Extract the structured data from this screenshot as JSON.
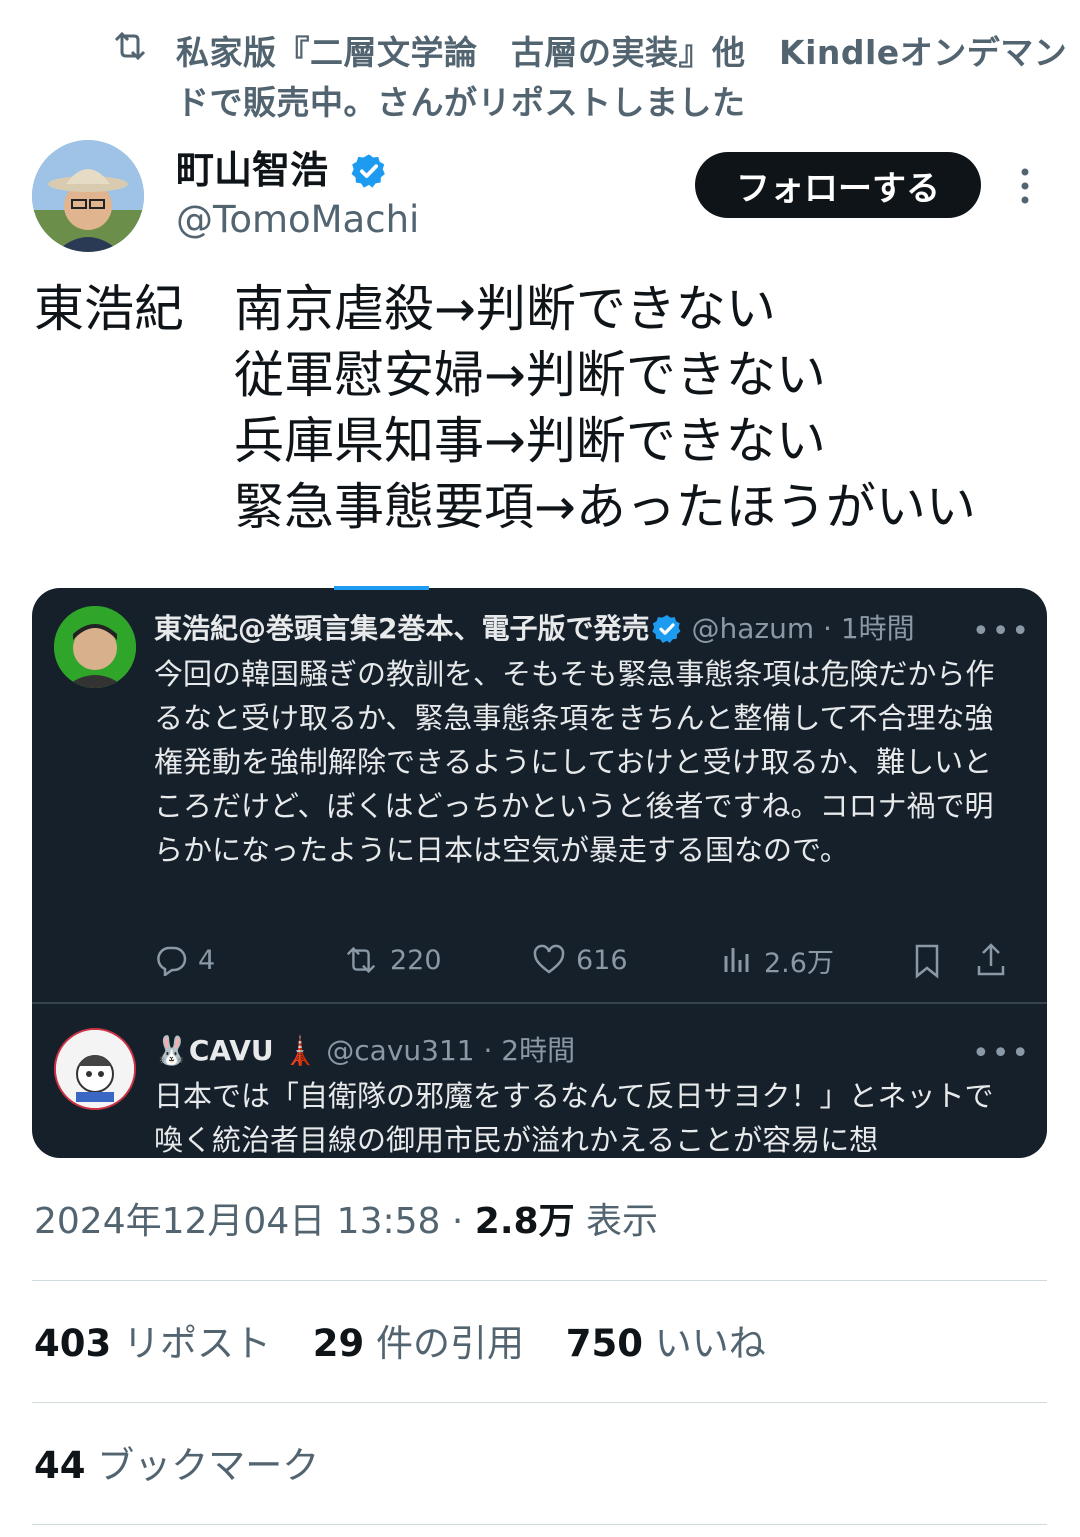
{
  "repost_header": {
    "text": "私家版『二層文学論　古層の実装』他　Kindleオンデマンドで販売中。さんがリポストしました",
    "icon": "repost-icon"
  },
  "author": {
    "name": "町山智浩",
    "handle": "@TomoMachi",
    "verified": true,
    "follow_label": "フォローする"
  },
  "post": {
    "label": "東浩紀",
    "lines": [
      "南京虐殺→判断できない",
      "従軍慰安婦→判断できない",
      "兵庫県知事→判断できない",
      "緊急事態要項→あったほうがいい"
    ]
  },
  "quoted": {
    "name": "東浩紀@巻頭言集2巻本、電子版で発売",
    "handle": "@hazum",
    "time": "1時間",
    "text": "今回の韓国騒ぎの教訓を、そもそも緊急事態条項は危険だから作るなと受け取るか、緊急事態条項をきちんと整備して不合理な強権発動を強制解除できるようにしておけと受け取るか、難しいところだけど、ぼくはどっちかというと後者ですね。コロナ禍で明らかになったように日本は空気が暴走する国なので。",
    "replies": "4",
    "reposts": "220",
    "likes": "616",
    "views": "2.6万"
  },
  "reply": {
    "name": "CAVU",
    "handle": "@cavu311",
    "time": "2時間",
    "text": "日本では「自衛隊の邪魔をするなんて反日サヨク！」とネットで喚く統治者目線の御用市民が溢れかえることが容易に想"
  },
  "meta": {
    "timestamp": "2024年12月04日 13:58",
    "dot": "·",
    "views_count": "2.8万",
    "views_label": "表示"
  },
  "stats": {
    "reposts_count": "403",
    "reposts_label": "リポスト",
    "quotes_count": "29",
    "quotes_label": "件の引用",
    "likes_count": "750",
    "likes_label": "いいね",
    "bookmarks_count": "44",
    "bookmarks_label": "ブックマーク"
  },
  "colors": {
    "accent": "#1d9bf0",
    "dark_bg": "#15202b",
    "secondary_text": "#536471"
  }
}
